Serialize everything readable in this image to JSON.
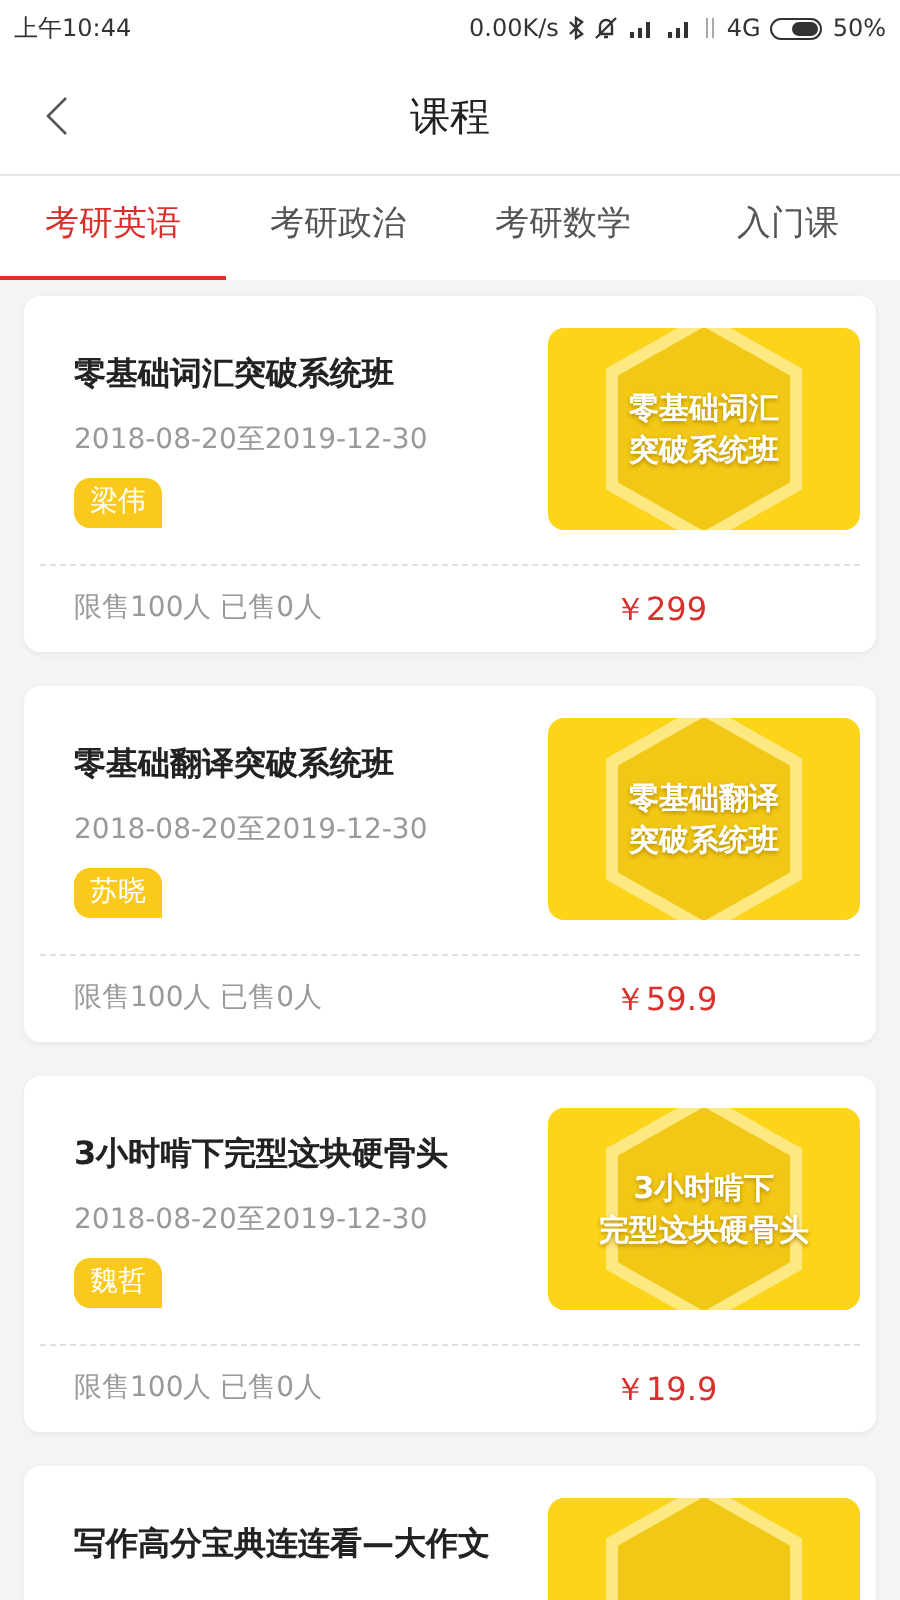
{
  "status_bar": {
    "time": "上午10:44",
    "speed": "0.00K/s",
    "network": "4G",
    "battery": "50%"
  },
  "header": {
    "title": "课程"
  },
  "tabs": [
    {
      "label": "考研英语",
      "selected": true
    },
    {
      "label": "考研政治",
      "selected": false
    },
    {
      "label": "考研数学",
      "selected": false
    },
    {
      "label": "入门课",
      "selected": false
    }
  ],
  "courses": [
    {
      "title": "零基础词汇突破系统班",
      "dates": "2018-08-20至2019-12-30",
      "teacher": "梁伟",
      "cover_lines": [
        "零基础词汇",
        "突破系统班"
      ],
      "quota": "限售100人 已售0人",
      "price": "￥299"
    },
    {
      "title": "零基础翻译突破系统班",
      "dates": "2018-08-20至2019-12-30",
      "teacher": "苏晓",
      "cover_lines": [
        "零基础翻译",
        "突破系统班"
      ],
      "quota": "限售100人 已售0人",
      "price": "￥59.9"
    },
    {
      "title": "3小时啃下完型这块硬骨头",
      "dates": "2018-08-20至2019-12-30",
      "teacher": "魏哲",
      "cover_lines": [
        "3小时啃下",
        "完型这块硬骨头"
      ],
      "quota": "限售100人 已售0人",
      "price": "￥19.9"
    },
    {
      "title": "写作高分宝典连连看—大作文"
    }
  ]
}
